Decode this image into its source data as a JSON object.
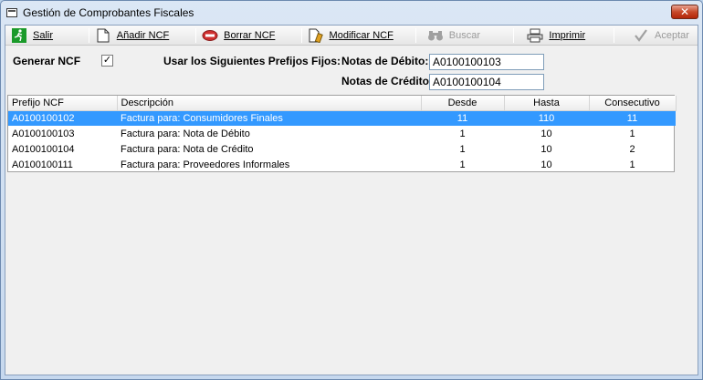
{
  "window": {
    "title": "Gestión de Comprobantes Fiscales",
    "close_label": "✕"
  },
  "toolbar": {
    "buttons": [
      {
        "label": "Salir",
        "icon": "exit-icon",
        "enabled": true
      },
      {
        "label": "Añadir NCF",
        "icon": "new-document-icon",
        "enabled": true
      },
      {
        "label": "Borrar NCF",
        "icon": "delete-icon",
        "enabled": true
      },
      {
        "label": "Modificar NCF",
        "icon": "edit-document-icon",
        "enabled": true
      },
      {
        "label": "Buscar",
        "icon": "binoculars-icon",
        "enabled": false
      },
      {
        "label": "Imprimir",
        "icon": "printer-icon",
        "enabled": true
      },
      {
        "label": "Aceptar",
        "icon": "checkmark-icon",
        "enabled": false
      }
    ]
  },
  "form": {
    "generar_label": "Generar NCF",
    "generar_checked": true,
    "check_mark": "✓",
    "prefijos_label": "Usar los Siguientes Prefijos Fijos:",
    "debito_label": "Notas de Débito:",
    "debito_value": "A0100100103",
    "credito_label": "Notas de Crédito:",
    "credito_value": "A0100100104"
  },
  "table": {
    "columns": [
      "Prefijo NCF",
      "Descripción",
      "Desde",
      "Hasta",
      "Consecutivo"
    ],
    "rows": [
      {
        "prefijo": "A0100100102",
        "descripcion": "Factura para: Consumidores Finales",
        "desde": "11",
        "hasta": "110",
        "consecutivo": "11",
        "selected": true
      },
      {
        "prefijo": "A0100100103",
        "descripcion": "Factura para: Nota de Débito",
        "desde": "1",
        "hasta": "10",
        "consecutivo": "1",
        "selected": false
      },
      {
        "prefijo": "A0100100104",
        "descripcion": "Factura para: Nota de Crédito",
        "desde": "1",
        "hasta": "10",
        "consecutivo": "2",
        "selected": false
      },
      {
        "prefijo": "A0100100111",
        "descripcion": "Factura para: Proveedores Informales",
        "desde": "1",
        "hasta": "10",
        "consecutivo": "1",
        "selected": false
      }
    ]
  },
  "colors": {
    "selection": "#3399ff",
    "exit_icon": "#1a9a2a",
    "delete_icon": "#d03030",
    "disabled_text": "#9a9a9a"
  }
}
